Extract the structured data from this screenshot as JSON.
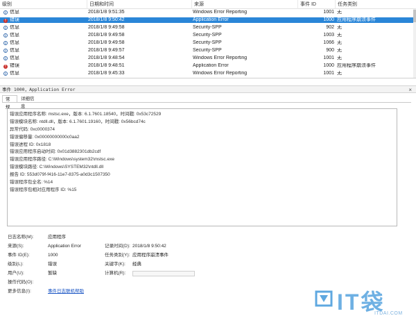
{
  "list": {
    "columns": {
      "level": "级别",
      "date": "日期和时间",
      "source": "来源",
      "event_id": "事件 ID",
      "category": "任务类别"
    },
    "rows": [
      {
        "level": "信息",
        "type": "info",
        "date": "2018/1/8 9:51:35",
        "source": "Windows Error Reporting",
        "event_id": "1001",
        "category": "无"
      },
      {
        "level": "错误",
        "type": "error",
        "date": "2018/1/8 9:50:42",
        "source": "Application Error",
        "event_id": "1000",
        "category": "应用程序崩溃事件",
        "selected": true
      },
      {
        "level": "信息",
        "type": "info",
        "date": "2018/1/8 9:49:58",
        "source": "Security-SPP",
        "event_id": "902",
        "category": "无"
      },
      {
        "level": "信息",
        "type": "info",
        "date": "2018/1/8 9:49:58",
        "source": "Security-SPP",
        "event_id": "1003",
        "category": "无"
      },
      {
        "level": "信息",
        "type": "info",
        "date": "2018/1/8 9:49:58",
        "source": "Security-SPP",
        "event_id": "1066",
        "category": "无"
      },
      {
        "level": "信息",
        "type": "info",
        "date": "2018/1/8 9:49:57",
        "source": "Security-SPP",
        "event_id": "900",
        "category": "无"
      },
      {
        "level": "信息",
        "type": "info",
        "date": "2018/1/8 9:48:54",
        "source": "Windows Error Reporting",
        "event_id": "1001",
        "category": "无"
      },
      {
        "level": "错误",
        "type": "error",
        "date": "2018/1/8 9:48:51",
        "source": "Application Error",
        "event_id": "1000",
        "category": "应用程序崩溃事件"
      },
      {
        "level": "信息",
        "type": "info",
        "date": "2018/1/8 9:45:33",
        "source": "Windows Error Reporting",
        "event_id": "1001",
        "category": "无"
      }
    ]
  },
  "detail": {
    "title": "事件 1000，Application Error",
    "close_glyph": "×",
    "tabs": {
      "general": "常规",
      "details": "详细信息"
    },
    "lines": [
      "错误应用程序名称: mstsc.exe，版本: 6.1.7601.18540，时间戳: 0x53c72529",
      "错误模块名称: ntdll.dll，版本: 6.1.7601.19160，时间戳: 0x56bcd74c",
      "异常代码: 0xc0000374",
      "错误偏移量: 0x00000000000c0aa2",
      "错误进程 ID: 0x1818",
      "错误应用程序启动时间: 0x01d3882301db2cdf",
      "错误应用程序路径: C:\\Windows\\system32\\mstsc.exe",
      "错误模块路径: C:\\Windows\\SYSTEM32\\ntdll.dll",
      "报告 ID: 553d079f-f416-11e7-8375-a0d3c1507350",
      "错误程序包全名: %14",
      "错误程序包相对应用程序 ID: %15"
    ],
    "props": {
      "log_name_label": "日志名称(M):",
      "log_name": "应用程序",
      "source_label": "来源(S):",
      "source": "Application Error",
      "logged_label": "记录时间(D):",
      "logged": "2018/1/8 9:50:42",
      "event_id_label": "事件 ID(E):",
      "event_id": "1000",
      "task_label": "任务类别(Y):",
      "task": "应用程序崩溃事件",
      "level_label": "级别(L):",
      "level": "错误",
      "keywords_label": "关键字(K):",
      "keywords": "经典",
      "user_label": "用户(U):",
      "user": "暂缺",
      "computer_label": "计算机(R):",
      "opcode_label": "操作代码(O):",
      "more_label": "更多信息(I):",
      "more_link": "事件日志联机帮助"
    }
  },
  "watermark": {
    "logo_text": "IT袋",
    "sub_text": "ITDAI.COM"
  },
  "colors": {
    "selection": "#2a86d8",
    "error": "#c9302c",
    "link": "#1a55c4"
  }
}
